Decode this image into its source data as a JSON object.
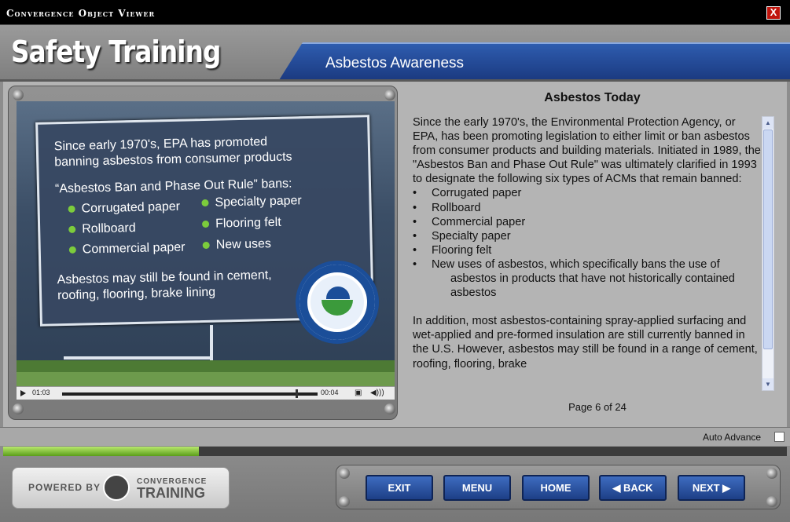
{
  "window": {
    "title": "Convergence Object Viewer",
    "close_label": "X"
  },
  "header": {
    "brand": "Safety Training",
    "topic": "Asbestos Awareness"
  },
  "slide": {
    "line1": "Since early 1970's, EPA has promoted",
    "line2": "banning asbestos from consumer products",
    "ban_title": "“Asbestos Ban and Phase Out Rule” bans:",
    "bullets_left": [
      "Corrugated paper",
      "Rollboard",
      "Commercial paper"
    ],
    "bullets_right": [
      "Specialty paper",
      "Flooring felt",
      "New uses"
    ],
    "footer1": "Asbestos may still be found in cement,",
    "footer2": "roofing, flooring, brake lining",
    "seal_icon": "epa-seal-icon"
  },
  "player": {
    "current_time": "01:03",
    "total_time": "00:04",
    "progress": 0.915
  },
  "content": {
    "heading": "Asbestos Today",
    "intro": "Since the early 1970's, the Environmental Protection Agency, or EPA, has been promoting legislation to either limit or ban asbestos from consumer products and building materials. Initiated in 1989, the \"Asbestos Ban and Phase Out Rule\" was ultimately clarified in 1993 to designate the following six types of ACMs that remain banned:",
    "bullets": [
      "Corrugated paper",
      "Rollboard",
      "Commercial paper",
      "Specialty paper",
      "Flooring felt"
    ],
    "last_bullet_a": "New uses of asbestos, which specifically bans the use of",
    "last_bullet_b": "asbestos in products that have not historically contained asbestos",
    "para2": "In addition, most asbestos-containing spray-applied surfacing and wet-applied and pre-formed insulation are still currently banned in the U.S. However, asbestos may still be found in a range of cement, roofing, flooring, brake"
  },
  "page_indicator": "Page 6 of 24",
  "auto_advance": {
    "label": "Auto Advance",
    "checked": false
  },
  "course_progress": 0.25,
  "footer": {
    "powered_by": "POWERED BY",
    "company_1": "CONVERGENCE",
    "company_2": "TRAINING"
  },
  "nav": {
    "exit": "EXIT",
    "menu": "MENU",
    "home": "HOME",
    "back": "◀ BACK",
    "next": "NEXT ▶"
  },
  "colors": {
    "accent": "#2e5caf",
    "progress": "#7ccc3c",
    "close": "#c0140c"
  }
}
